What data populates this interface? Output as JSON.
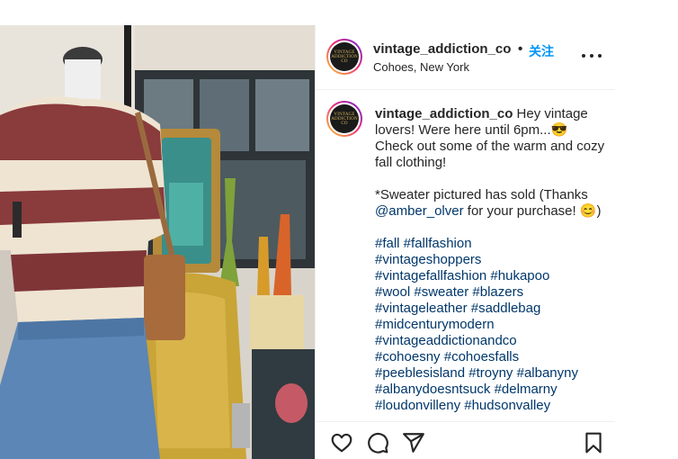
{
  "post": {
    "username": "vintage_addiction_co",
    "separator": "•",
    "follow_label": "关注",
    "location": "Cohoes, New York",
    "avatar_text": "VINTAGE ADDICTION CO"
  },
  "caption": {
    "username": "vintage_addiction_co",
    "line1": " Hey vintage lovers! Were here until 6pm...😎 Check out some of the warm and cozy fall clothing!",
    "line2_prefix": "*Sweater pictured has sold (Thanks ",
    "mention": "@amber_olver",
    "line2_suffix": " for your purchase! 😊)",
    "hashtags": [
      "#fall #fallfashion",
      "#vintageshoppers",
      "#vintagefallfashion #hukapoo",
      "#wool #sweater #blazers",
      "#vintageleather #saddlebag",
      "#midcenturymodern",
      "#vintageaddictionandco",
      "#cohoesny #cohoesfalls",
      "#peeblesisland #troyny #albanyny",
      "#albanydoesntsuck #delmarny",
      "#loudonvilleny #hudsonvalley"
    ]
  },
  "icons": {
    "like": "heart-icon",
    "comment": "comment-icon",
    "share": "send-icon",
    "save": "bookmark-icon",
    "more": "more-icon"
  },
  "colors": {
    "follow": "#0095f6",
    "link": "#00376b",
    "text": "#262626"
  }
}
